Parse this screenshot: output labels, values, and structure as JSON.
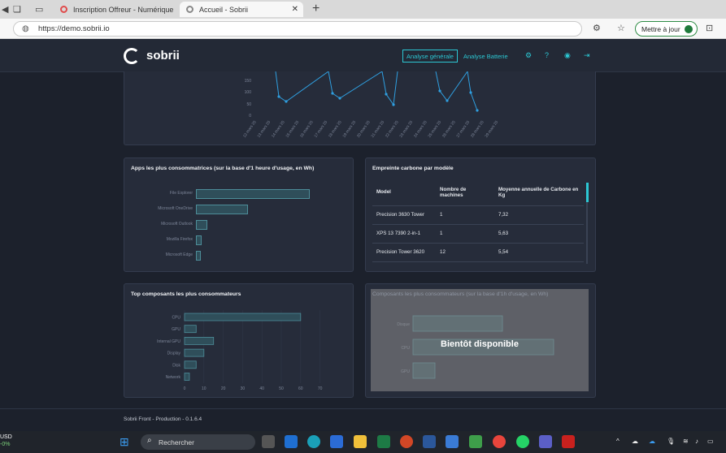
{
  "browser": {
    "tabs": [
      {
        "title": "Inscription Offreur - Numérique",
        "active": false
      },
      {
        "title": "Accueil - Sobrii",
        "active": true
      }
    ],
    "url": "https://demo.sobrii.io",
    "update_button": "Mettre à jour"
  },
  "header": {
    "logo": "sobrii",
    "nav": {
      "general": "Analyse générale",
      "battery": "Analyse Batterie"
    }
  },
  "line_chart": {
    "y_ticks": [
      "150",
      "100",
      "50",
      "0"
    ],
    "x_dates": [
      "12 mars 25",
      "13 mars 25",
      "14 mars 25",
      "15 mars 25",
      "16 mars 25",
      "17 mars 25",
      "18 mars 25",
      "19 mars 25",
      "20 mars 25",
      "21 mars 25",
      "22 mars 25",
      "23 mars 25",
      "24 mars 25",
      "25 mars 25",
      "26 mars 25",
      "27 mars 25",
      "28 mars 25",
      "29 mars 25"
    ]
  },
  "apps_card": {
    "title": "Apps les plus consommatrices (sur la base d'1 heure d'usage, en Wh)",
    "items": [
      {
        "label": "File Explorer",
        "value": 100
      },
      {
        "label": "Microsoft OneDrive",
        "value": 46
      },
      {
        "label": "Microsoft Outlook",
        "value": 10
      },
      {
        "label": "Mozilla Firefox",
        "value": 5
      },
      {
        "label": "Microsoft Edge",
        "value": 4
      }
    ]
  },
  "carbon_card": {
    "title": "Empreinte carbone par modèle",
    "headers": [
      "Model",
      "Nombre de machines",
      "Moyenne annuelle de Carbone en Kg"
    ],
    "rows": [
      [
        "Precision 3630 Tower",
        "1",
        "7,32"
      ],
      [
        "XPS 13 7390 2-in-1",
        "1",
        "5,63"
      ],
      [
        "Precision Tower 3620",
        "12",
        "5,54"
      ]
    ]
  },
  "components_card": {
    "title": "Top composants les plus consommateurs",
    "items": [
      {
        "label": "CPU",
        "value": 60
      },
      {
        "label": "GPU",
        "value": 6
      },
      {
        "label": "Internal GPU",
        "value": 15
      },
      {
        "label": "Display",
        "value": 10
      },
      {
        "label": "Disk",
        "value": 6
      },
      {
        "label": "Network",
        "value": 2.5
      }
    ],
    "x_ticks": [
      "0",
      "10",
      "20",
      "30",
      "40",
      "50",
      "60",
      "70"
    ]
  },
  "components_hour_card": {
    "title": "Composants les plus consommateurs (sur la base d'1h d'usage, en Wh)",
    "overlay": "Bientôt disponible",
    "labels": [
      "Disque",
      "CPU",
      "GPU"
    ]
  },
  "footer": "Sobrii Front - Production - 0.1.6.4",
  "taskbar": {
    "currency": "USD",
    "change": "-0%",
    "search": "Rechercher"
  },
  "colors": {
    "accent": "#2cc7d3",
    "bar_fill": "#2f4e5a",
    "bar_border": "#4d8d99",
    "card_bg": "#262c3a",
    "page_bg": "#1c212c"
  }
}
